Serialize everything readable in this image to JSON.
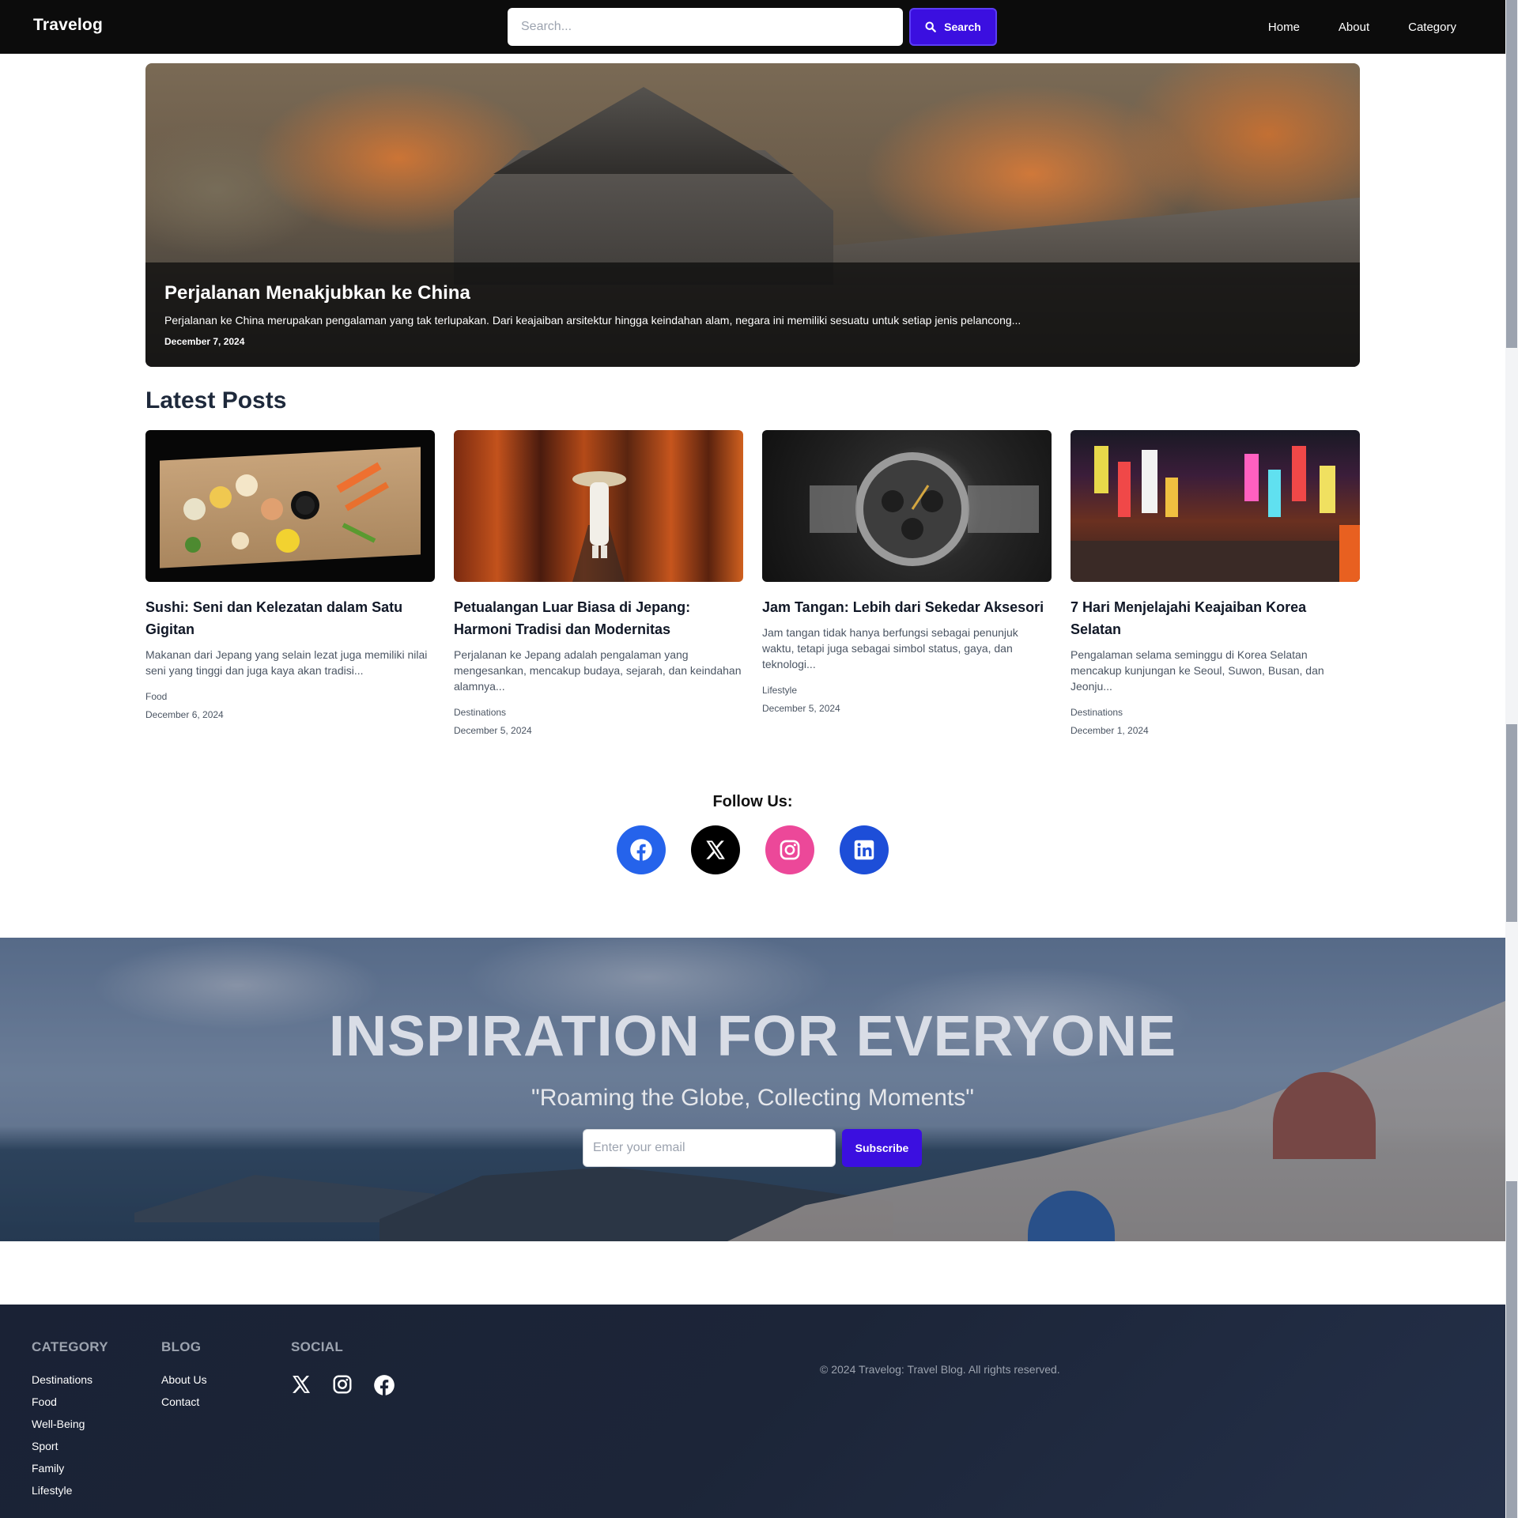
{
  "brand": "Travelog",
  "search": {
    "placeholder": "Search...",
    "button_label": "Search"
  },
  "nav": {
    "items": [
      "Home",
      "About",
      "Category"
    ]
  },
  "hero": {
    "title": "Perjalanan Menakjubkan ke China",
    "excerpt": "Perjalanan ke China merupakan pengalaman yang tak terlupakan. Dari keajaiban arsitektur hingga keindahan alam, negara ini memiliki sesuatu untuk setiap jenis pelancong...",
    "date": "December 7, 2024"
  },
  "latest": {
    "heading": "Latest Posts",
    "posts": [
      {
        "title": "Sushi: Seni dan Kelezatan dalam Satu Gigitan",
        "excerpt": "Makanan dari Jepang yang selain lezat juga memiliki nilai seni yang tinggi dan juga kaya akan tradisi...",
        "category": "Food",
        "date": "December 6, 2024"
      },
      {
        "title": "Petualangan Luar Biasa di Jepang: Harmoni Tradisi dan Modernitas",
        "excerpt": "Perjalanan ke Jepang adalah pengalaman yang mengesankan, mencakup budaya, sejarah, dan keindahan alamnya...",
        "category": "Destinations",
        "date": "December 5, 2024"
      },
      {
        "title": "Jam Tangan: Lebih dari Sekedar Aksesori",
        "excerpt": "Jam tangan tidak hanya berfungsi sebagai penunjuk waktu, tetapi juga sebagai simbol status, gaya, dan teknologi...",
        "category": "Lifestyle",
        "date": "December 5, 2024"
      },
      {
        "title": "7 Hari Menjelajahi Keajaiban Korea Selatan",
        "excerpt": "Pengalaman selama seminggu di Korea Selatan mencakup kunjungan ke Seoul, Suwon, Busan, dan Jeonju...",
        "category": "Destinations",
        "date": "December 1, 2024"
      }
    ]
  },
  "follow": {
    "heading": "Follow Us:",
    "icons": [
      "facebook-icon",
      "x-icon",
      "instagram-icon",
      "linkedin-icon"
    ],
    "colors": {
      "facebook": "#2563eb",
      "x": "#000000",
      "instagram": "#ec4899",
      "linkedin": "#1d4ed8"
    }
  },
  "banner": {
    "heading": "INSPIRATION FOR EVERYONE",
    "quote": "\"Roaming the Globe, Collecting Moments\"",
    "email_placeholder": "Enter your email",
    "subscribe_label": "Subscribe"
  },
  "footer": {
    "category": {
      "heading": "CATEGORY",
      "links": [
        "Destinations",
        "Food",
        "Well-Being",
        "Sport",
        "Family",
        "Lifestyle"
      ]
    },
    "blog": {
      "heading": "BLOG",
      "links": [
        "About Us",
        "Contact"
      ]
    },
    "social": {
      "heading": "SOCIAL",
      "icons": [
        "x-icon",
        "instagram-icon",
        "facebook-icon"
      ]
    },
    "copyright": "© 2024 Travelog: Travel Blog. All rights reserved."
  },
  "colors": {
    "accent": "#3b0fe0",
    "navbar": "#0c0c0c",
    "footer": "#1a2235"
  }
}
